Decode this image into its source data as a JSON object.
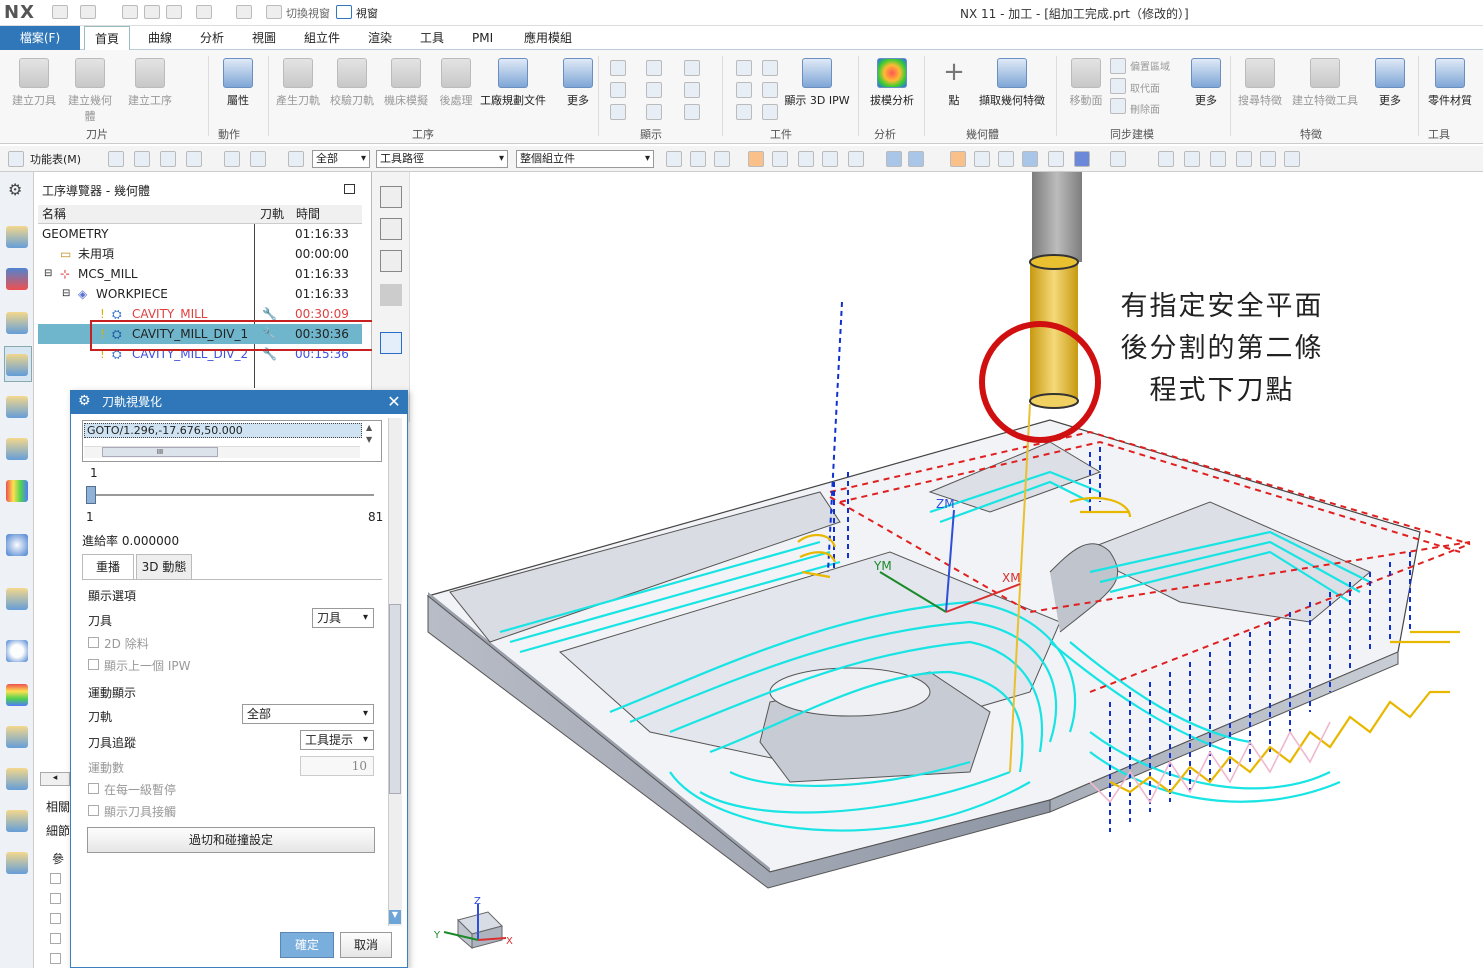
{
  "app": {
    "logo": "NX",
    "window_title": "NX 11 - 加工 - [組加工完成.prt（修改的）]",
    "switch_window": "切換視窗",
    "window_menu": "視窗"
  },
  "menu": {
    "file": "檔案(F)",
    "tabs": [
      "首頁",
      "曲線",
      "分析",
      "視圖",
      "組立件",
      "渲染",
      "工具",
      "PMI",
      "應用模組"
    ]
  },
  "ribbon": {
    "buttons": [
      "建立刀具",
      "建立幾何體",
      "建立工序",
      "屬性",
      "產生刀軌",
      "校驗刀軌",
      "機床模擬",
      "後處理",
      "工廠規劃文件",
      "更多",
      "顯示 3D IPW",
      "拔模分析",
      "點",
      "擷取幾何特徵",
      "移動面",
      "更多",
      "搜尋特徵",
      "建立特徵工具",
      "更多",
      "零件材質"
    ],
    "small_buttons": [
      "偏置區域",
      "取代面",
      "刪除面"
    ],
    "groups": [
      "刀片",
      "動作",
      "工序",
      "顯示",
      "工件",
      "分析",
      "幾何體",
      "同步建模",
      "特徵",
      "工具"
    ]
  },
  "toolbar2": {
    "function_menu": "功能表(M)",
    "filter_all": "全部",
    "filter_type": "工具路徑",
    "filter_scope": "整個組立件"
  },
  "navigator": {
    "title": "工序導覽器 - 幾何體",
    "columns": [
      "名稱",
      "刀軌",
      "時間"
    ],
    "rows": [
      {
        "name": "GEOMETRY",
        "time": "01:16:33"
      },
      {
        "name": "未用項",
        "time": "00:00:00"
      },
      {
        "name": "MCS_MILL",
        "time": "01:16:33"
      },
      {
        "name": "WORKPIECE",
        "time": "01:16:33"
      },
      {
        "name": "CAVITY_MILL",
        "time": "00:30:09"
      },
      {
        "name": "CAVITY_MILL_DIV_1",
        "time": "00:30:36"
      },
      {
        "name": "CAVITY_MILL_DIV_2",
        "time": "00:15:36"
      }
    ],
    "bottom_tabs": [
      "相關",
      "細節",
      "參"
    ]
  },
  "dialog": {
    "title": "刀軌視覺化",
    "goto_line": "GOTO/1.296,-17.676,50.000",
    "goto_scroll_thumb": "III",
    "slider_value": "1",
    "slider_min": "1",
    "slider_max": "81",
    "slider_fraction": 0.0,
    "feed_rate": "進給率 0.000000",
    "tabs": [
      "重播",
      "3D 動態"
    ],
    "display_options": "顯示選項",
    "tool_label": "刀具",
    "tool_value": "刀具",
    "opt_2d_removal": "2D 除料",
    "opt_prev_ipw": "顯示上一個 IPW",
    "motion_display": "運動顯示",
    "path_label": "刀軌",
    "path_value": "全部",
    "tool_trace_label": "刀具追蹤",
    "tool_trace_value": "工具提示",
    "motion_count_label": "運動數",
    "motion_count_value": "10",
    "pause_each_level": "在每一級暫停",
    "show_tool_holder": "顯示刀具接觸",
    "gouge_settings": "過切和碰撞設定",
    "ok": "確定",
    "cancel": "取消"
  },
  "viewport": {
    "annotation_lines": [
      "有指定安全平面",
      "後分割的第二條",
      "程式下刀點"
    ],
    "axis_labels": {
      "zm": "ZM",
      "ym": "YM",
      "xm": "XM",
      "z": "Z",
      "y": "Y",
      "x": "X"
    }
  },
  "colors": {
    "accent": "#2f77b8",
    "toolpath": "#18e4e4",
    "rapid": "#e02020",
    "engage": "#1030d0",
    "tool": "#e8c030",
    "highlight_circle": "#d01010"
  }
}
